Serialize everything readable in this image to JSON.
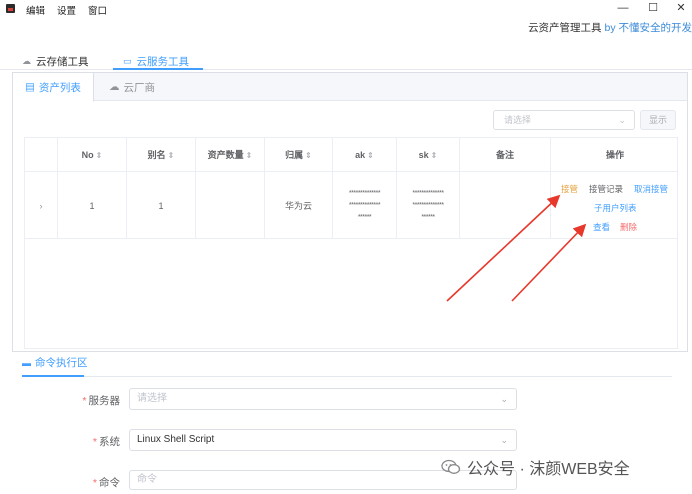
{
  "menu": [
    "编辑",
    "设置",
    "窗口"
  ],
  "window_controls": {
    "minimize": "—",
    "maximize": "☐",
    "close": "✕"
  },
  "app_title": {
    "text": "云资产管理工具",
    "by": "by 不懂安全的开发"
  },
  "top_tabs": [
    {
      "label": "云存储工具",
      "icon": "cloud-icon"
    },
    {
      "label": "云服务工具",
      "icon": "monitor-icon"
    }
  ],
  "inner_tabs": [
    {
      "label": "资产列表",
      "icon": "list-icon"
    },
    {
      "label": "云厂商",
      "icon": "cloud-icon"
    }
  ],
  "filter": {
    "placeholder": "请选择",
    "show_button": "显示"
  },
  "table": {
    "headers": [
      "No",
      "别名",
      "资产数量",
      "归属",
      "ak",
      "sk",
      "备注",
      "操作"
    ],
    "row": {
      "no": "1",
      "alias": "1",
      "asset_count": "",
      "owner": "华为云",
      "ak": [
        "**************",
        "**************",
        "******"
      ],
      "sk": [
        "**************",
        "**************",
        "******"
      ],
      "remark": ""
    },
    "actions": {
      "takeover": "接管",
      "takeover_log": "接管记录",
      "cancel_takeover": "取消接管",
      "sub_user_list": "子用户列表",
      "view": "查看",
      "delete": "删除"
    }
  },
  "command_section": {
    "title": "命令执行区",
    "server_label": "服务器",
    "server_placeholder": "请选择",
    "system_label": "系统",
    "system_value": "Linux Shell Script",
    "command_label": "命令",
    "command_placeholder": "命令"
  },
  "watermark": "公众号 · 沫颜WEB安全",
  "colors": {
    "accent": "#409eff",
    "warning": "#e6a23c",
    "danger": "#f56c6c",
    "annotation": "#e8372b"
  }
}
